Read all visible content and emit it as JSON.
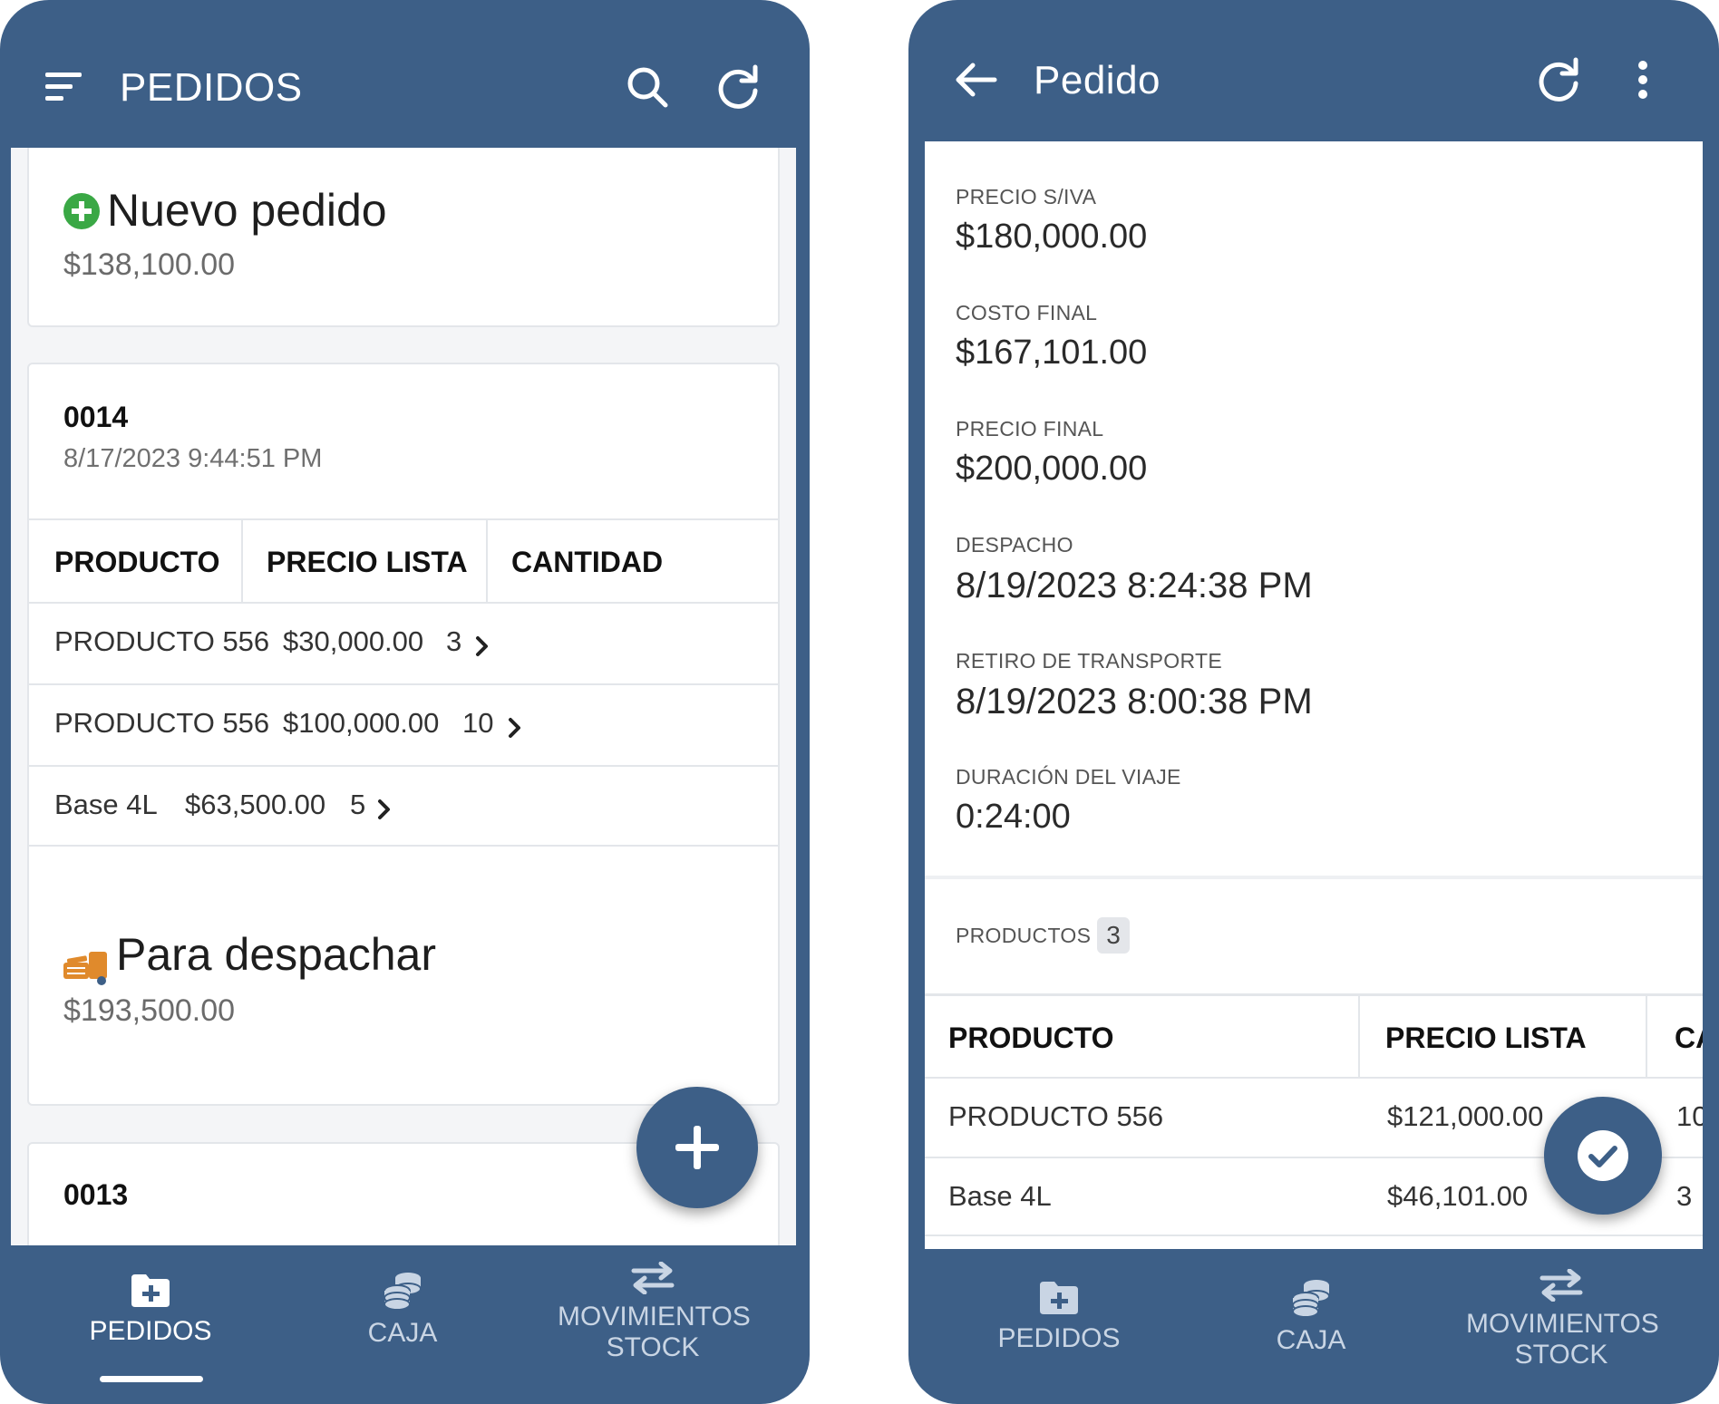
{
  "left": {
    "header": {
      "title": "PEDIDOS"
    },
    "new_order": {
      "title": "Nuevo pedido",
      "amount": "$138,100.00"
    },
    "order": {
      "number": "0014",
      "datetime": "8/17/2023 9:44:51 PM",
      "columns": [
        "PRODUCTO",
        "PRECIO LISTA",
        "CANTIDAD"
      ],
      "rows": [
        {
          "product": "PRODUCTO 556",
          "price": "$30,000.00",
          "qty": "3"
        },
        {
          "product": "PRODUCTO 556",
          "price": "$100,000.00",
          "qty": "10"
        },
        {
          "product": "Base 4L",
          "price": "$63,500.00",
          "qty": "5"
        }
      ]
    },
    "dispatch": {
      "title": "Para despachar",
      "amount": "$193,500.00"
    },
    "next_order": {
      "number": "0013"
    },
    "nav": {
      "pedidos": "PEDIDOS",
      "caja": "CAJA",
      "mov1": "MOVIMIENTOS",
      "mov2": "STOCK"
    }
  },
  "right": {
    "header": {
      "title": "Pedido"
    },
    "fields": [
      {
        "label": "PRECIO S/IVA",
        "value": "$180,000.00"
      },
      {
        "label": "COSTO FINAL",
        "value": "$167,101.00"
      },
      {
        "label": "PRECIO FINAL",
        "value": "$200,000.00"
      },
      {
        "label": "DESPACHO",
        "value": "8/19/2023 8:24:38 PM"
      },
      {
        "label": "RETIRO DE TRANSPORTE",
        "value": "8/19/2023 8:00:38 PM"
      },
      {
        "label": "DURACIÓN DEL VIAJE",
        "value": "0:24:00"
      }
    ],
    "products_label": "PRODUCTOS",
    "products_count": "3",
    "columns": [
      "PRODUCTO",
      "PRECIO LISTA",
      "CA"
    ],
    "rows": [
      {
        "product": "PRODUCTO 556",
        "price": "$121,000.00",
        "qty": "10"
      },
      {
        "product": "Base 4L",
        "price": "$46,101.00",
        "qty": "3"
      }
    ],
    "nav": {
      "pedidos": "PEDIDOS",
      "caja": "CAJA",
      "mov1": "MOVIMIENTOS",
      "mov2": "STOCK"
    }
  },
  "colors": {
    "primary": "#3d5f87",
    "success": "#3aa845",
    "dispatch": "#e08a2c"
  }
}
